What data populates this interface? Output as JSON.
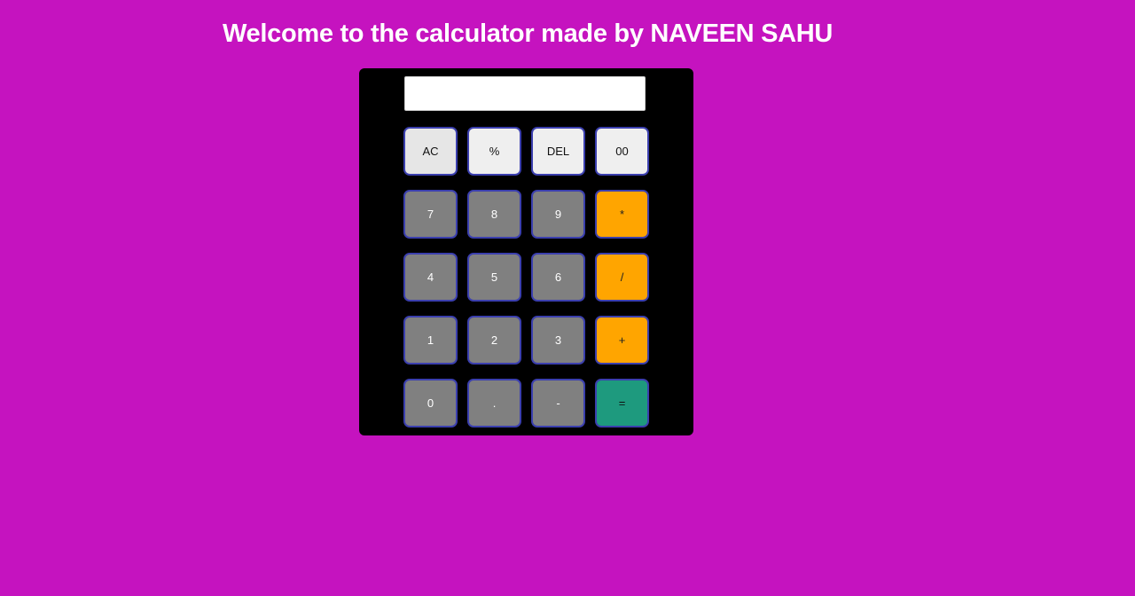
{
  "header": {
    "title": "Welcome to the calculator made by NAVEEN SAHU"
  },
  "display": {
    "value": ""
  },
  "keys": {
    "ac": "AC",
    "percent": "%",
    "del": "DEL",
    "double_zero": "00",
    "seven": "7",
    "eight": "8",
    "nine": "9",
    "multiply": "*",
    "four": "4",
    "five": "5",
    "six": "6",
    "divide": "/",
    "one": "1",
    "two": "2",
    "three": "3",
    "plus": "+",
    "zero": "0",
    "dot": ".",
    "minus": "-",
    "equals": "="
  },
  "colors": {
    "background": "#c513bf",
    "calculator_body": "#000000",
    "function_key": "#efefef",
    "number_key": "#808080",
    "operator_key": "#ffa500",
    "equals_key": "#1e9a7e",
    "key_border": "#3b3fae"
  }
}
